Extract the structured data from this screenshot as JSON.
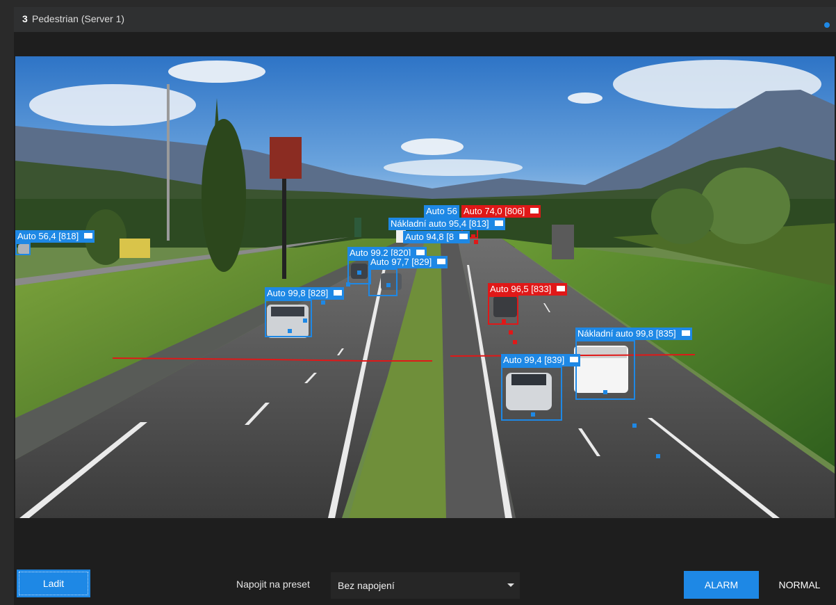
{
  "window": {
    "camera_number": "3",
    "camera_name": "Pedestrian (Server 1)",
    "status_color": "#1e88e5"
  },
  "colors": {
    "accent": "#1e88e5",
    "alarm_red": "#e01818"
  },
  "detections": [
    {
      "label": "Auto 56,4 [818]",
      "color": "blue"
    },
    {
      "label": "Auto 56",
      "color": "blue"
    },
    {
      "label": "Auto 74,0 [806]",
      "color": "red"
    },
    {
      "label": "Nákladní auto 95,4 [813]",
      "color": "blue"
    },
    {
      "label": "Auto 94,8 [8",
      "color": "blue"
    },
    {
      "label": "Auto 99,2 [820]",
      "color": "blue"
    },
    {
      "label": "Auto 97,7 [829]",
      "color": "blue"
    },
    {
      "label": "Auto 99,8 [828]",
      "color": "blue"
    },
    {
      "label": "Auto 96,5 [833]",
      "color": "red"
    },
    {
      "label": "Nákladní auto 99,8 [835]",
      "color": "blue"
    },
    {
      "label": "Auto 99,4 [839]",
      "color": "blue"
    }
  ],
  "footer": {
    "tune_button": "Ladit",
    "preset_label": "Napojit na preset",
    "preset_value": "Bez napojení",
    "alarm_button": "ALARM",
    "normal_button": "NORMAL"
  }
}
